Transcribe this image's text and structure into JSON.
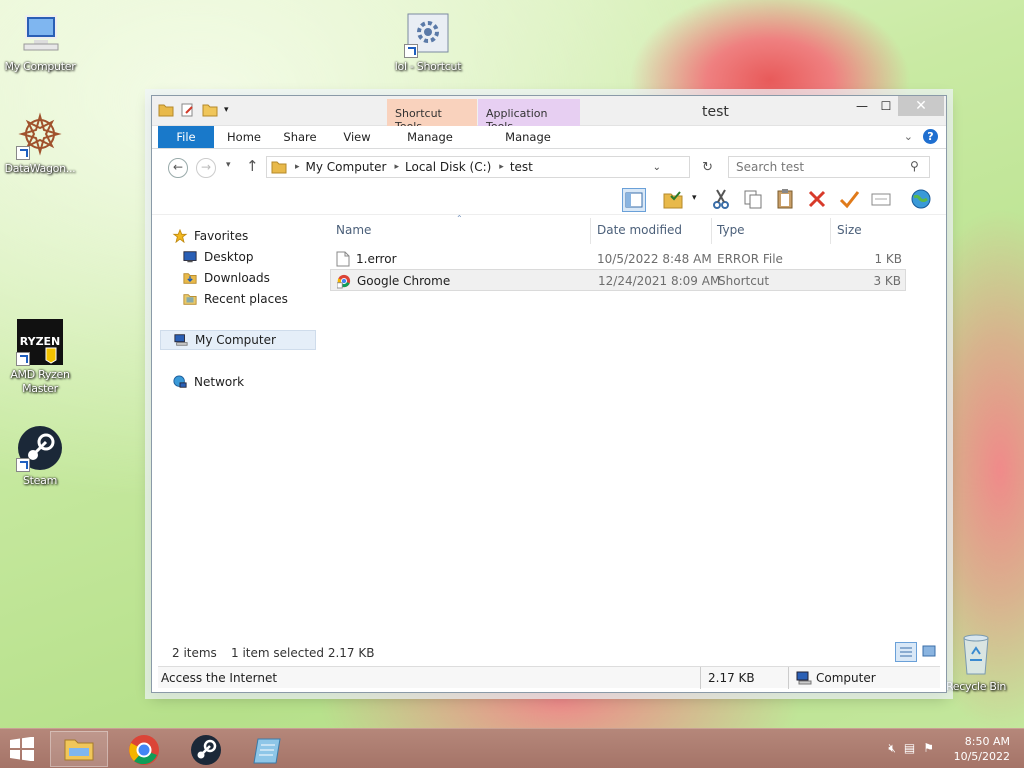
{
  "desktop": {
    "icons": [
      {
        "label": "My Computer"
      },
      {
        "label": "DataWagon..."
      },
      {
        "label": "AMD Ryzen Master"
      },
      {
        "label": "Steam"
      },
      {
        "label": "lol - Shortcut"
      },
      {
        "label": "Recycle Bin"
      }
    ]
  },
  "window": {
    "title": "test",
    "context_tabs": {
      "shortcut_tools": "Shortcut Tools",
      "application_tools": "Application Tools"
    },
    "ribbon_tabs": [
      "File",
      "Home",
      "Share",
      "View",
      "Manage",
      "Manage"
    ],
    "address": {
      "segments": [
        "My Computer",
        "Local Disk (C:)",
        "test"
      ]
    },
    "search": {
      "placeholder": "Search test"
    },
    "nav": {
      "favorites": "Favorites",
      "desktop": "Desktop",
      "downloads": "Downloads",
      "recent": "Recent places",
      "my_computer": "My Computer",
      "network": "Network"
    },
    "columns": {
      "name": "Name",
      "date": "Date modified",
      "type": "Type",
      "size": "Size"
    },
    "files": [
      {
        "name": "1.error",
        "date": "10/5/2022 8:48 AM",
        "type": "ERROR File",
        "size": "1 KB"
      },
      {
        "name": "Google Chrome",
        "date": "12/24/2021 8:09 AM",
        "type": "Shortcut",
        "size": "3 KB"
      }
    ],
    "status": {
      "items": "2 items",
      "selected": "1 item selected  2.17 KB",
      "description": "Access the Internet",
      "size": "2.17 KB",
      "zone": "Computer"
    }
  },
  "taskbar": {
    "clock_time": "8:50 AM",
    "clock_date": "10/5/2022"
  },
  "colors": {
    "file_tab": "#1979ca",
    "shortcut_tools": "#f9d2bd",
    "application_tools": "#e7cff2",
    "taskbar": "#a57468"
  }
}
